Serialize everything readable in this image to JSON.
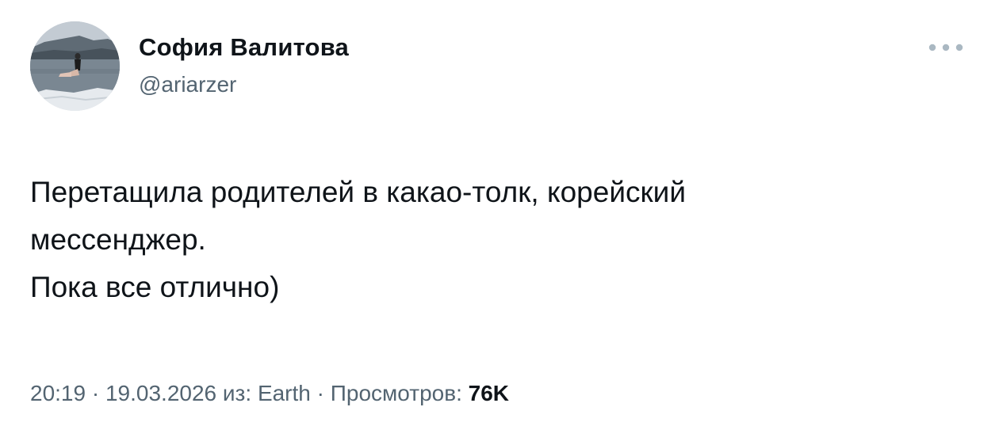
{
  "tweet": {
    "author": {
      "display_name": "София Валитова",
      "handle": "@ariarzer",
      "avatar_icon": "profile-photo-avatar"
    },
    "more_icon": "more-horizontal-icon",
    "text": "Перетащила родителей в какао-толк, корейский\nмессенджер.\nПока все отлично)",
    "meta": {
      "time": "20:19",
      "separator": " · ",
      "date": "19.03.2026",
      "source_prefix": "из: ",
      "source": "Earth",
      "views_label": "Просмотров: ",
      "views_count": "76K"
    }
  },
  "colors": {
    "text_primary": "#0f1419",
    "text_secondary": "#536471",
    "more_dots": "#aab8c2",
    "background": "#ffffff"
  }
}
